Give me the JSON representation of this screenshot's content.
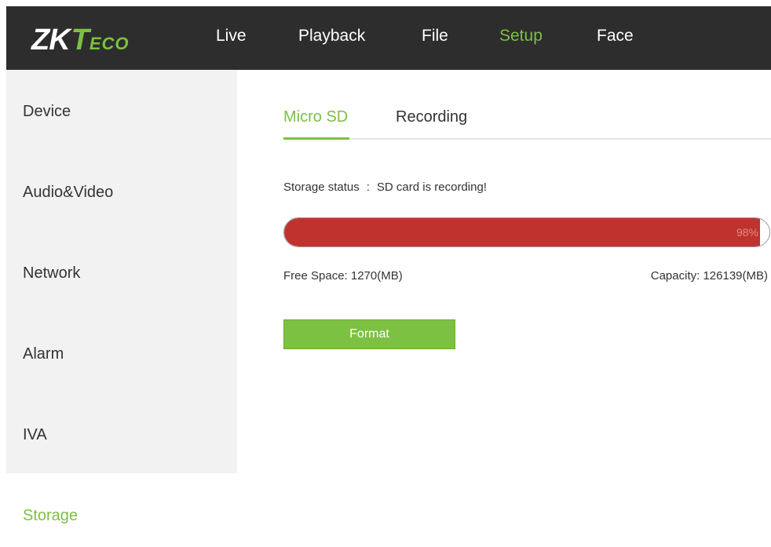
{
  "logo": {
    "zk": "ZK",
    "t": "T",
    "eco": "ECO"
  },
  "nav": {
    "items": [
      {
        "label": "Live"
      },
      {
        "label": "Playback"
      },
      {
        "label": "File"
      },
      {
        "label": "Setup",
        "active": true
      },
      {
        "label": "Face"
      }
    ]
  },
  "sidebar": {
    "items": [
      {
        "label": "Device"
      },
      {
        "label": "Audio&Video"
      },
      {
        "label": "Network"
      },
      {
        "label": "Alarm"
      },
      {
        "label": "IVA"
      },
      {
        "label": "Storage",
        "active": true
      }
    ]
  },
  "tabs": {
    "items": [
      {
        "label": "Micro SD",
        "active": true
      },
      {
        "label": "Recording"
      }
    ]
  },
  "storage": {
    "status_label": "Storage status",
    "status_separator": ":",
    "status_value": "SD card is recording!",
    "usage_percent": 98,
    "usage_text": "98%",
    "free_space": "Free Space: 1270(MB)",
    "capacity": "Capacity: 126139(MB)",
    "format_label": "Format"
  },
  "colors": {
    "accent": "#7cc142",
    "topbar": "#2d2d2d",
    "sidebar": "#f2f2f2",
    "progress_fill": "#c0322e"
  }
}
